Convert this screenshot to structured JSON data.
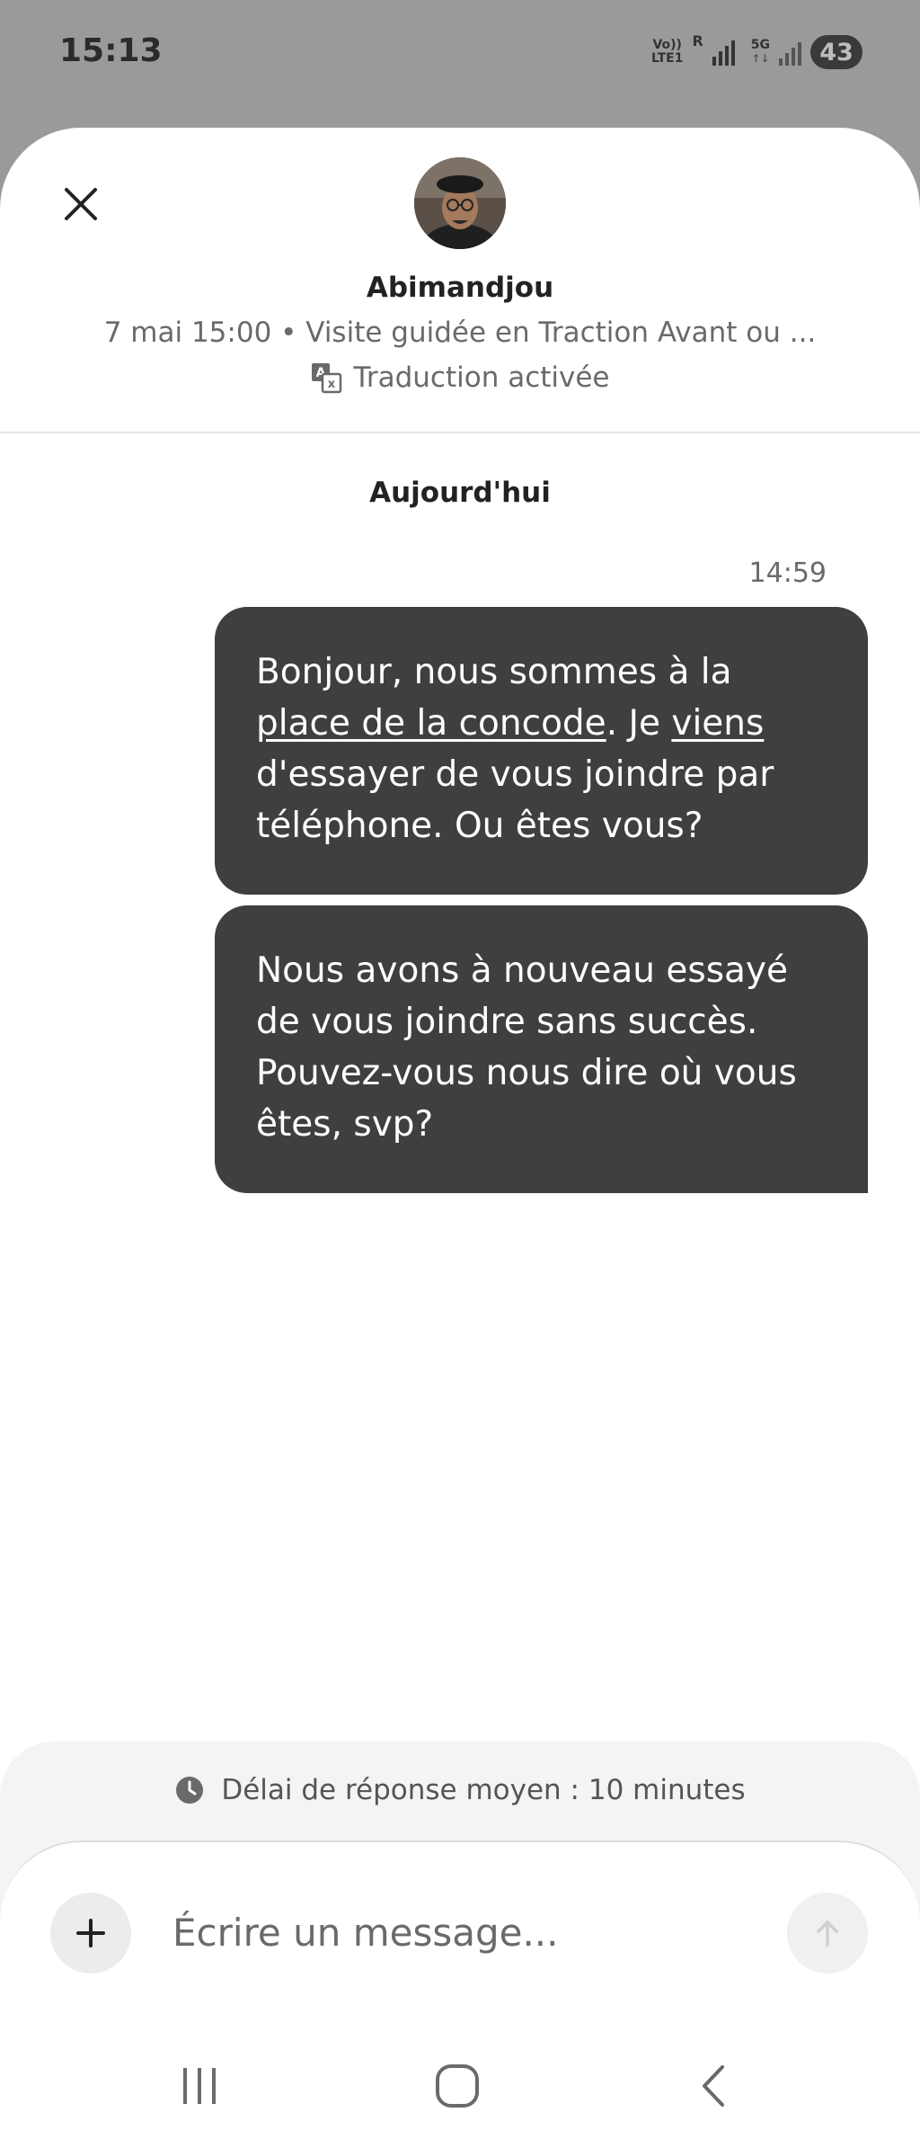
{
  "status_bar": {
    "time": "15:13",
    "volte_label_top": "Vo))",
    "volte_label_bottom": "LTE1",
    "sim_label": "R",
    "network_label": "5G",
    "battery": "43"
  },
  "header": {
    "host_name": "Abimandjou",
    "trip_info": "7 mai 15:00 • Visite guidée en Traction Avant ou ...",
    "translation_status": "Traduction activée"
  },
  "conversation": {
    "date_separator": "Aujourd'hui",
    "time_stamp": "14:59",
    "messages": [
      {
        "part1": "Bonjour,  nous sommes à la ",
        "link1": "place de la concode",
        "part2": ". Je ",
        "link2": "viens",
        "part3": " d'essayer de vous joindre par téléphone.  Ou êtes vous?"
      },
      {
        "text": "Nous avons à nouveau essayé de vous joindre sans succès. Pouvez-vous nous dire où vous êtes,  svp?"
      }
    ]
  },
  "footer": {
    "response_time": "Délai de réponse moyen : 10 minutes",
    "input_placeholder": "Écrire un message..."
  },
  "icons": {
    "close": "close-icon",
    "translate": "translate-icon",
    "clock": "clock-icon",
    "add": "plus-icon",
    "send": "arrow-up-icon",
    "nav_recents": "recents-icon",
    "nav_home": "home-icon",
    "nav_back": "back-icon"
  }
}
